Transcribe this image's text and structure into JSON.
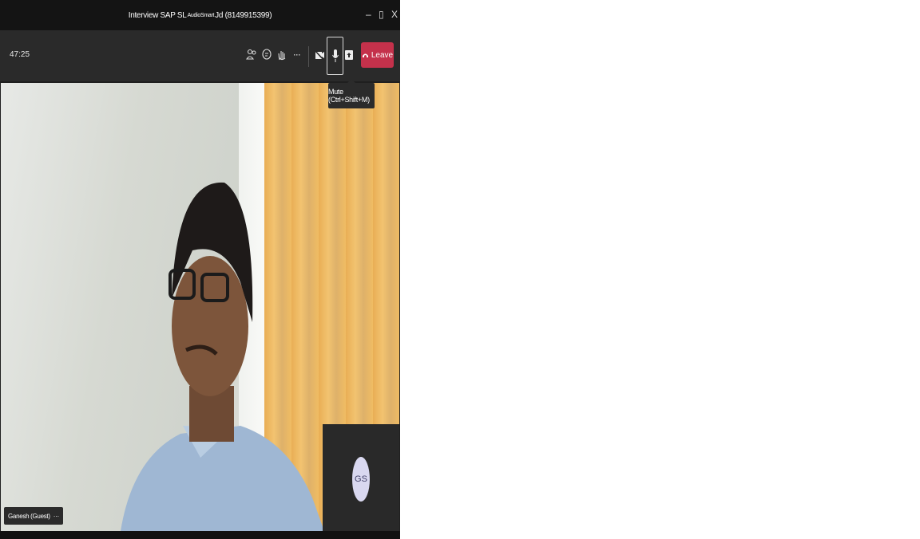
{
  "window": {
    "title_prefix": "Interview SAP SL",
    "title_overlay": "AudioSmart",
    "title_suffix": "Jd (8149915399)",
    "minimize": "–",
    "maximize": "▯",
    "close": "X"
  },
  "toolbar": {
    "timer": "47:25",
    "leave_label": "Leave",
    "more": "···"
  },
  "tooltip": {
    "text": "Mute (Ctrl+Shift+M)"
  },
  "participant": {
    "name": "Ganesh (Guest)",
    "more": "···"
  },
  "self_tile": {
    "initials": "GS"
  },
  "colors": {
    "leave": "#c4314b",
    "avatar_bg": "#d9d8f0",
    "toolbar": "#2a2a2a"
  }
}
